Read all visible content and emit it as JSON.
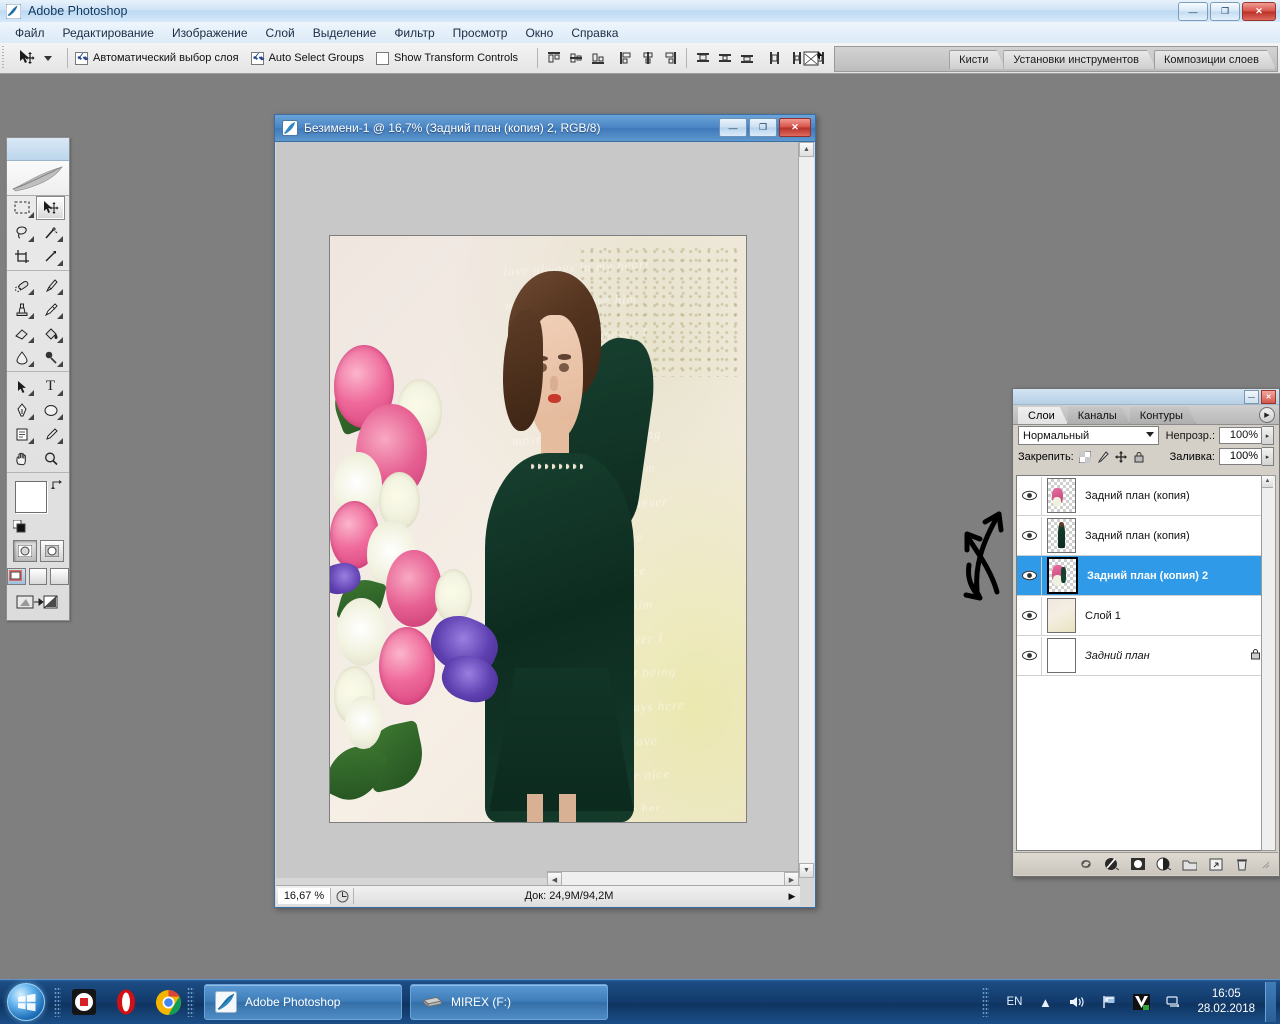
{
  "app": {
    "title": "Adobe Photoshop",
    "window_controls": {
      "minimize": "—",
      "maximize": "❐",
      "close": "✕"
    }
  },
  "menubar": {
    "items": [
      {
        "label": "Файл"
      },
      {
        "label": "Редактирование"
      },
      {
        "label": "Изображение"
      },
      {
        "label": "Слой"
      },
      {
        "label": "Выделение"
      },
      {
        "label": "Фильтр"
      },
      {
        "label": "Просмотр"
      },
      {
        "label": "Окно"
      },
      {
        "label": "Справка"
      }
    ]
  },
  "options_bar": {
    "tool_icon": "move-tool-icon",
    "checkboxes": [
      {
        "label": "Автоматический выбор слоя",
        "checked": true
      },
      {
        "label": "Auto Select Groups",
        "checked": true
      },
      {
        "label": "Show Transform Controls",
        "checked": false
      }
    ],
    "align_group_1": [
      "align-top-edges-icon",
      "align-vertical-centers-icon",
      "align-bottom-edges-icon"
    ],
    "align_group_2": [
      "align-left-edges-icon",
      "align-horizontal-centers-icon",
      "align-right-edges-icon"
    ],
    "distribute_group_1": [
      "distribute-top-edges-icon",
      "distribute-vertical-centers-icon",
      "distribute-bottom-edges-icon"
    ],
    "distribute_group_2": [
      "distribute-left-edges-icon",
      "distribute-horizontal-centers-icon",
      "distribute-right-edges-icon"
    ],
    "link_icon": "link-layers-icon"
  },
  "palette_well": {
    "tabs": [
      {
        "label": "Кисти"
      },
      {
        "label": "Установки инструментов"
      },
      {
        "label": "Композиции слоев"
      }
    ]
  },
  "toolbox": {
    "rows": [
      [
        {
          "icon": "rectangular-marquee-icon",
          "glyph": "▭",
          "selected": false,
          "has_flyout": true
        },
        {
          "icon": "move-tool-icon",
          "glyph": "✥",
          "selected": true,
          "has_flyout": false
        }
      ],
      [
        {
          "icon": "lasso-tool-icon",
          "glyph": "◌",
          "selected": false,
          "has_flyout": true
        },
        {
          "icon": "magic-wand-icon",
          "glyph": "✺",
          "selected": false,
          "has_flyout": true
        }
      ],
      [
        {
          "icon": "crop-tool-icon",
          "glyph": "⌗",
          "selected": false,
          "has_flyout": false
        },
        {
          "icon": "slice-tool-icon",
          "glyph": "✂",
          "selected": false,
          "has_flyout": true
        }
      ],
      [
        {
          "icon": "healing-brush-icon",
          "glyph": "✏",
          "selected": false,
          "has_flyout": true
        },
        {
          "icon": "brush-tool-icon",
          "glyph": "🖌",
          "selected": false,
          "has_flyout": true
        }
      ],
      [
        {
          "icon": "clone-stamp-icon",
          "glyph": "⚗",
          "selected": false,
          "has_flyout": true
        },
        {
          "icon": "history-brush-icon",
          "glyph": "✒",
          "selected": false,
          "has_flyout": true
        }
      ],
      [
        {
          "icon": "eraser-tool-icon",
          "glyph": "▱",
          "selected": false,
          "has_flyout": true
        },
        {
          "icon": "paint-bucket-icon",
          "glyph": "⬗",
          "selected": false,
          "has_flyout": true
        }
      ],
      [
        {
          "icon": "blur-tool-icon",
          "glyph": "💧",
          "selected": false,
          "has_flyout": true
        },
        {
          "icon": "dodge-tool-icon",
          "glyph": "🔍",
          "selected": false,
          "has_flyout": true
        }
      ],
      [
        {
          "icon": "path-selection-icon",
          "glyph": "➤",
          "selected": false,
          "has_flyout": true
        },
        {
          "icon": "type-tool-icon",
          "glyph": "T",
          "selected": false,
          "has_flyout": true
        }
      ],
      [
        {
          "icon": "pen-tool-icon",
          "glyph": "✎",
          "selected": false,
          "has_flyout": true
        },
        {
          "icon": "ellipse-shape-icon",
          "glyph": "⬭",
          "selected": false,
          "has_flyout": true
        }
      ],
      [
        {
          "icon": "notes-tool-icon",
          "glyph": "🗒",
          "selected": false,
          "has_flyout": true
        },
        {
          "icon": "eyedropper-tool-icon",
          "glyph": "⌖",
          "selected": false,
          "has_flyout": true
        }
      ],
      [
        {
          "icon": "hand-tool-icon",
          "glyph": "✋",
          "selected": false,
          "has_flyout": false
        },
        {
          "icon": "zoom-tool-icon",
          "glyph": "🔎",
          "selected": false,
          "has_flyout": false
        }
      ]
    ],
    "foreground_color": "#ffffff",
    "background_color": "#c6e21b",
    "swap_icon": "swap-colors-icon",
    "default_icon": "default-colors-icon",
    "quick_mask": [
      {
        "icon": "standard-mode-icon",
        "active": true
      },
      {
        "icon": "quick-mask-mode-icon",
        "active": false
      }
    ],
    "screen_modes": [
      {
        "icon": "standard-screen-mode-icon",
        "active": true
      },
      {
        "icon": "full-screen-with-menubar-icon",
        "active": false
      },
      {
        "icon": "full-screen-mode-icon",
        "active": false
      }
    ],
    "jump_button": {
      "icon": "jump-to-imageready-icon"
    }
  },
  "document": {
    "title": "Безимени-1 @ 16,7% (Задний план (копия) 2, RGB/8)",
    "icon": "photoshop-document-icon",
    "window_controls": {
      "minimize": "—",
      "maximize": "❐",
      "close": "✕"
    },
    "status": {
      "zoom": "16,67 %",
      "doc_icon": "doc-info-icon",
      "doc_size": "Док: 24,9M/94,2M",
      "arrow": "▶"
    }
  },
  "layers_panel": {
    "window_controls": {
      "minimize": "—",
      "close": "✕"
    },
    "tabs": [
      {
        "label": "Слои",
        "active": true
      },
      {
        "label": "Каналы",
        "active": false
      },
      {
        "label": "Контуры",
        "active": false
      }
    ],
    "menu_icon": "panel-menu-icon",
    "blend_mode": "Нормальный",
    "opacity_label": "Непрозр.:",
    "opacity_value": "100%",
    "lock_label": "Закрепить:",
    "lock_icons": [
      {
        "icon": "lock-transparent-pixels-icon"
      },
      {
        "icon": "lock-image-pixels-icon"
      },
      {
        "icon": "lock-position-icon"
      },
      {
        "icon": "lock-all-icon"
      }
    ],
    "fill_label": "Заливка:",
    "fill_value": "100%",
    "layers": [
      {
        "name": "Задний план (копия)",
        "visible": true,
        "selected": false,
        "thumb": "transparent",
        "locked": false,
        "italic": false
      },
      {
        "name": "Задний план (копия)",
        "visible": true,
        "selected": false,
        "thumb": "figure",
        "locked": false,
        "italic": false
      },
      {
        "name": "Задний план (копия) 2",
        "visible": true,
        "selected": true,
        "thumb": "transparent",
        "locked": false,
        "italic": false
      },
      {
        "name": "Слой 1",
        "visible": true,
        "selected": false,
        "thumb": "paper",
        "locked": false,
        "italic": false
      },
      {
        "name": "Задний план",
        "visible": true,
        "selected": false,
        "thumb": "white",
        "locked": true,
        "italic": true
      }
    ],
    "bottom_buttons": [
      {
        "icon": "link-layers-icon",
        "glyph": "⚭"
      },
      {
        "icon": "layer-style-fx-icon",
        "glyph": "❂"
      },
      {
        "icon": "add-layer-mask-icon",
        "glyph": "◙"
      },
      {
        "icon": "new-adjustment-layer-icon",
        "glyph": "◑"
      },
      {
        "icon": "new-group-icon",
        "glyph": "🗀"
      },
      {
        "icon": "new-layer-icon",
        "glyph": "▣"
      },
      {
        "icon": "delete-layer-icon",
        "glyph": "🗑"
      }
    ]
  },
  "annotation": {
    "name": "hand-drawn-double-arrow",
    "description": "curved up and down arrows pointing at layer stack"
  },
  "taskbar": {
    "start_icon": "windows-start-orb-icon",
    "quick_launch": [
      {
        "icon": "security-shield-icon"
      },
      {
        "icon": "opera-browser-icon"
      },
      {
        "icon": "google-chrome-icon"
      }
    ],
    "tasks": [
      {
        "label": "Adobe Photoshop",
        "icon": "photoshop-feather-icon",
        "active": true
      },
      {
        "label": "MIREX (F:)",
        "icon": "usb-drive-icon",
        "active": false
      }
    ],
    "tray": {
      "language": "EN",
      "show_hidden_icon": "show-hidden-icons-chevron",
      "icons": [
        {
          "icon": "volume-speaker-icon",
          "glyph": "🔊"
        },
        {
          "icon": "action-center-flag-icon",
          "glyph": "⚑"
        },
        {
          "icon": "antivirus-icon",
          "glyph": "V"
        },
        {
          "icon": "network-icon",
          "glyph": "🖧"
        }
      ],
      "time": "16:05",
      "date": "28.02.2018"
    }
  }
}
